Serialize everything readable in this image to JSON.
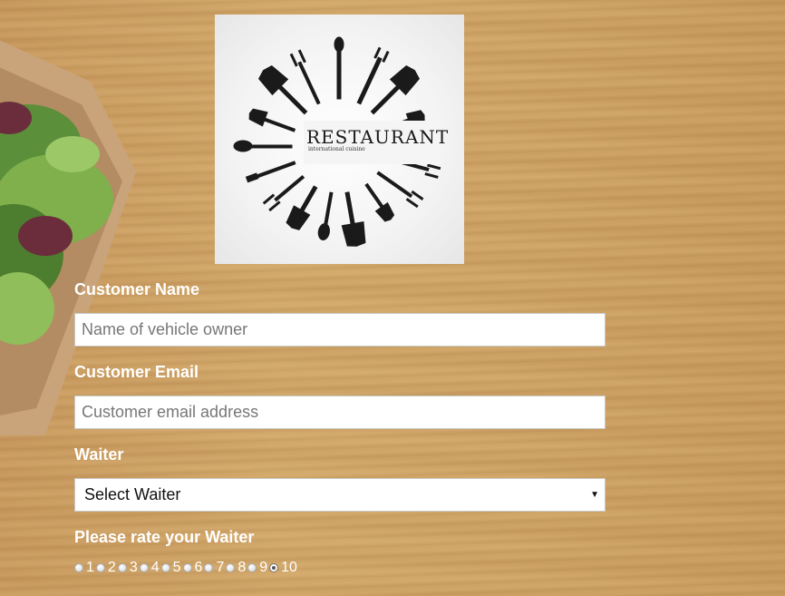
{
  "logo": {
    "title": "RESTAURANT",
    "subtitle": "international cuisine"
  },
  "form": {
    "name_label": "Customer Name",
    "name_placeholder": "Name of vehicle owner",
    "email_label": "Customer Email",
    "email_placeholder": "Customer email address",
    "waiter_label": "Waiter",
    "waiter_selected": "Select Waiter",
    "rating_label": "Please rate your Waiter",
    "rating_options": [
      "1",
      "2",
      "3",
      "4",
      "5",
      "6",
      "7",
      "8",
      "9",
      "10"
    ],
    "rating_selected": "10"
  }
}
